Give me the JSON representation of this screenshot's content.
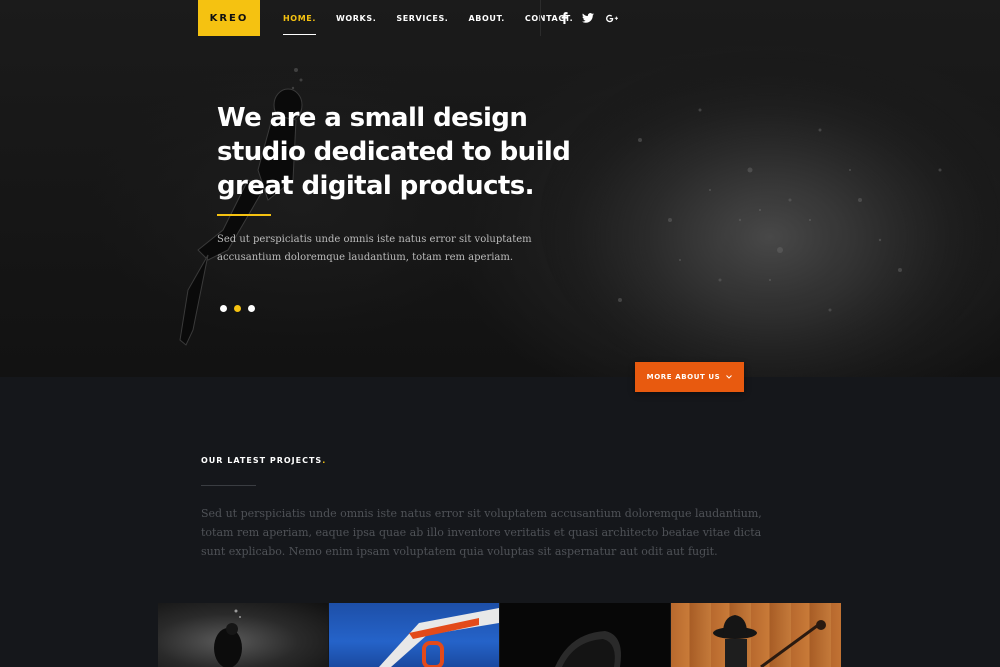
{
  "brand": {
    "logo_text": "KREO",
    "accent_color": "#f5c211",
    "button_color": "#e85a0f"
  },
  "nav": {
    "items": [
      {
        "label": "HOME.",
        "active": true
      },
      {
        "label": "WORKS."
      },
      {
        "label": "SERVICES."
      },
      {
        "label": "ABOUT."
      },
      {
        "label": "CONTACT."
      }
    ]
  },
  "social": {
    "icons": [
      "facebook-icon",
      "twitter-icon",
      "google-plus-icon"
    ]
  },
  "hero": {
    "title": "We are a small design studio dedicated to build great digital products.",
    "description": "Sed ut perspiciatis unde omnis iste natus error sit voluptatem accusantium doloremque laudantium, totam rem aperiam.",
    "slides": {
      "count": 3,
      "active_index": 1
    },
    "more_button": {
      "label": "MORE ABOUT US",
      "icon": "chevron-down-icon"
    }
  },
  "projects": {
    "title": "OUR LATEST PROJECTS",
    "title_accent": ".",
    "description": "Sed ut perspiciatis unde omnis iste natus error sit voluptatem accusantium doloremque laudantium, totam rem aperiam, eaque ipsa quae ab illo inventore veritatis et quasi architecto beatae vitae dicta sunt explicabo. Nemo enim ipsam voluptatem quia voluptas sit aspernatur aut odit aut fugit."
  }
}
